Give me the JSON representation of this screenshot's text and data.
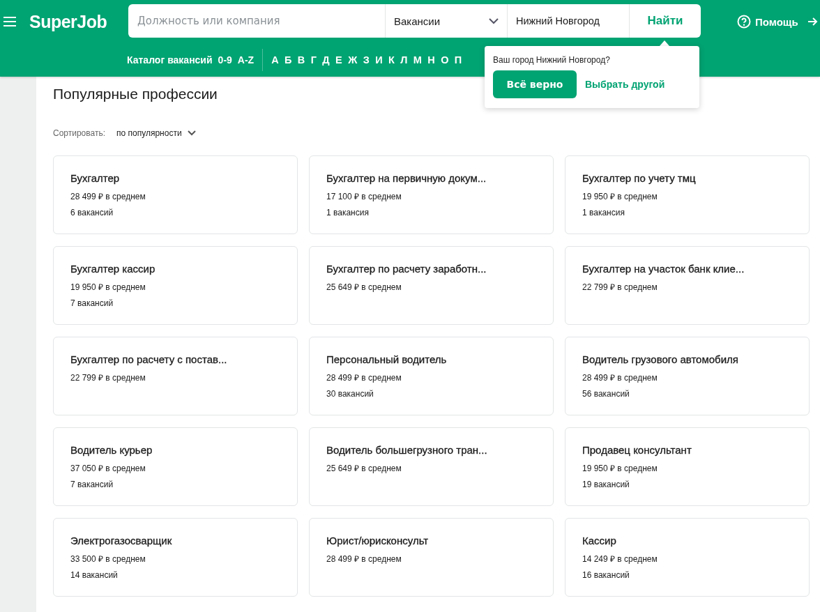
{
  "header": {
    "logo": "SuperJob",
    "search": {
      "placeholder": "Должность или компания"
    },
    "category": "Вакансии",
    "city": "Нижний Новгород",
    "search_button": "Найти",
    "help": "Помощь"
  },
  "catalog": {
    "label": "Каталог вакансий",
    "ranges": [
      "0-9",
      "A-Z"
    ],
    "letters": [
      "А",
      "Б",
      "В",
      "Г",
      "Д",
      "Е",
      "Ж",
      "З",
      "И",
      "К",
      "Л",
      "М",
      "Н",
      "О",
      "П"
    ]
  },
  "city_popup": {
    "question": "Ваш город Нижний Новгород?",
    "confirm": "Всё верно",
    "other": "Выбрать другой"
  },
  "title": "Популярные профессии",
  "sort": {
    "label": "Сортировать:",
    "value": "по популярности"
  },
  "professions": [
    {
      "name": "Бухгалтер",
      "salary": "28 499 ₽ в среднем",
      "count": "6 вакансий"
    },
    {
      "name": "Бухгалтер на первичную докум...",
      "salary": "17 100 ₽ в среднем",
      "count": "1 вакансия"
    },
    {
      "name": "Бухгалтер по учету тмц",
      "salary": "19 950 ₽ в среднем",
      "count": "1 вакансия"
    },
    {
      "name": "Бухгалтер кассир",
      "salary": "19 950 ₽ в среднем",
      "count": "7 вакансий"
    },
    {
      "name": "Бухгалтер по расчету заработн...",
      "salary": "25 649 ₽ в среднем"
    },
    {
      "name": "Бухгалтер на участок банк клие...",
      "salary": "22 799 ₽ в среднем"
    },
    {
      "name": "Бухгалтер по расчету с постав...",
      "salary": "22 799 ₽ в среднем"
    },
    {
      "name": "Персональный водитель",
      "salary": "28 499 ₽ в среднем",
      "count": "30 вакансий"
    },
    {
      "name": "Водитель грузового автомобиля",
      "salary": "28 499 ₽ в среднем",
      "count": "56 вакансий"
    },
    {
      "name": "Водитель курьер",
      "salary": "37 050 ₽ в среднем",
      "count": "7 вакансий"
    },
    {
      "name": "Водитель большегрузного тран...",
      "salary": "25 649 ₽ в среднем"
    },
    {
      "name": "Продавец консультант",
      "salary": "19 950 ₽ в среднем",
      "count": "19 вакансий"
    },
    {
      "name": "Электрогазосварщик",
      "salary": "33 500 ₽ в среднем",
      "count": "14 вакансий"
    },
    {
      "name": "Юрист/юрисконсульт",
      "salary": "28 499 ₽ в среднем"
    },
    {
      "name": "Кассир",
      "salary": "14 249 ₽ в среднем",
      "count": "16 вакансий"
    }
  ]
}
